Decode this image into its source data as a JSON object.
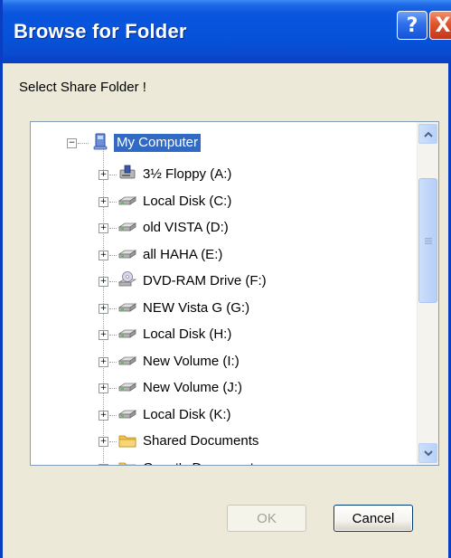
{
  "window": {
    "title": "Browse for Folder",
    "help_glyph": "?",
    "close_glyph": "X"
  },
  "instruction": "Select Share Folder !",
  "tree": {
    "root": {
      "label": "My Computer",
      "icon": "computer-icon",
      "expander": "−",
      "selected": true
    },
    "items": [
      {
        "label": "3½ Floppy (A:)",
        "icon": "floppy-drive-icon",
        "expander": "+"
      },
      {
        "label": "Local Disk (C:)",
        "icon": "hard-drive-icon",
        "expander": "+"
      },
      {
        "label": "old VISTA (D:)",
        "icon": "hard-drive-icon",
        "expander": "+"
      },
      {
        "label": "all HAHA (E:)",
        "icon": "hard-drive-icon",
        "expander": "+"
      },
      {
        "label": "DVD-RAM Drive (F:)",
        "icon": "dvd-drive-icon",
        "expander": "+"
      },
      {
        "label": "NEW Vista G (G:)",
        "icon": "hard-drive-icon",
        "expander": "+"
      },
      {
        "label": "Local Disk (H:)",
        "icon": "hard-drive-icon",
        "expander": "+"
      },
      {
        "label": "New Volume (I:)",
        "icon": "hard-drive-icon",
        "expander": "+"
      },
      {
        "label": "New Volume (J:)",
        "icon": "hard-drive-icon",
        "expander": "+"
      },
      {
        "label": "Local Disk (K:)",
        "icon": "hard-drive-icon",
        "expander": "+"
      },
      {
        "label": "Shared Documents",
        "icon": "folder-icon",
        "expander": "+"
      },
      {
        "label": "Guest's Documents",
        "icon": "folder-icon",
        "expander": "+"
      }
    ]
  },
  "buttons": {
    "ok": "OK",
    "cancel": "Cancel"
  },
  "colors": {
    "title_bar": "#0553d8",
    "selection": "#316ac5",
    "close": "#e0542c"
  }
}
